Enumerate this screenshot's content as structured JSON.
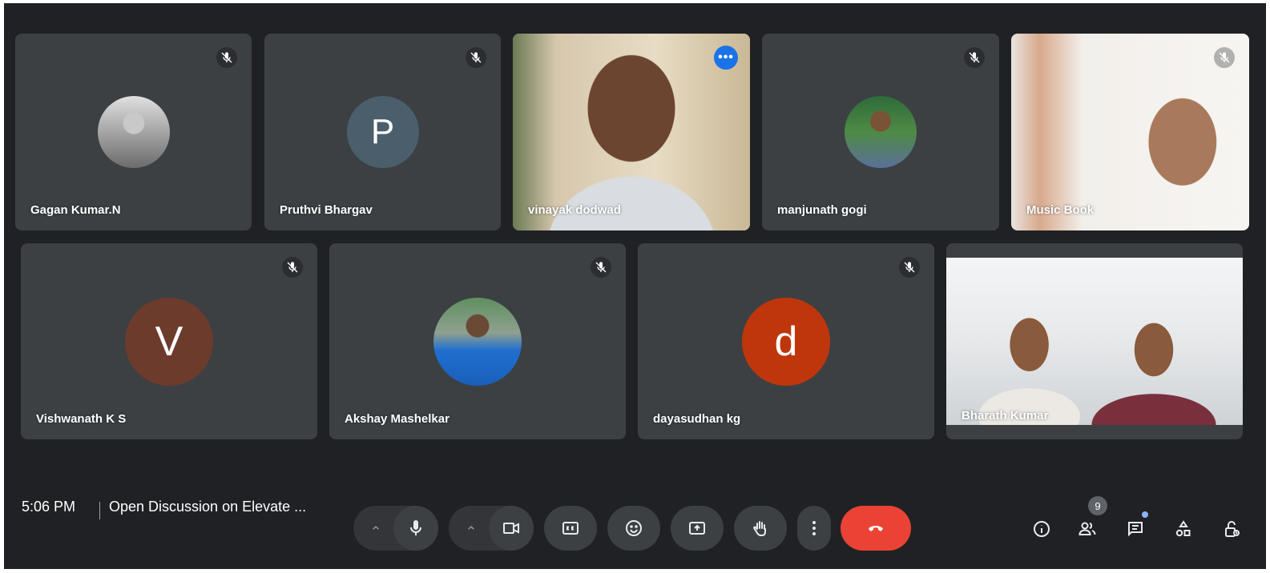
{
  "participants": [
    {
      "name": "Gagan Kumar.N",
      "kind": "photo",
      "muted": true
    },
    {
      "name": "Pruthvi Bhargav",
      "kind": "initial",
      "initial": "P",
      "color": "#4a5f6b",
      "muted": true
    },
    {
      "name": "vinayak dodwad",
      "kind": "video",
      "active_speaker": true,
      "muted": false
    },
    {
      "name": "manjunath gogi",
      "kind": "photo",
      "muted": true
    },
    {
      "name": "Music Book",
      "kind": "video",
      "muted": true
    },
    {
      "name": "Vishwanath K S",
      "kind": "initial",
      "initial": "V",
      "color": "#6d3b2c",
      "muted": true
    },
    {
      "name": "Akshay Mashelkar",
      "kind": "photo",
      "muted": true
    },
    {
      "name": "dayasudhan kg",
      "kind": "initial",
      "initial": "d",
      "color": "#bf360c",
      "muted": true
    },
    {
      "name": "Bharath Kumar",
      "kind": "video",
      "muted": false
    }
  ],
  "footer": {
    "time": "5:06 PM",
    "separator": "|",
    "meeting_title": "Open Discussion on Elevate ...",
    "people_count": "9"
  },
  "controls": {
    "icons": [
      "caret-up-icon",
      "microphone-icon",
      "caret-up-icon",
      "camera-icon",
      "captions-icon",
      "emoji-icon",
      "present-screen-icon",
      "raise-hand-icon",
      "more-vert-icon",
      "call-end-icon"
    ],
    "end_call_color": "#ea4335"
  },
  "side_panel": {
    "icons": [
      "info-icon",
      "people-icon",
      "chat-icon",
      "activities-icon",
      "host-controls-icon"
    ]
  },
  "colors": {
    "background": "#202124",
    "tile": "#3c4043",
    "accent": "#8ab4f8",
    "more_button": "#1a73e8"
  }
}
